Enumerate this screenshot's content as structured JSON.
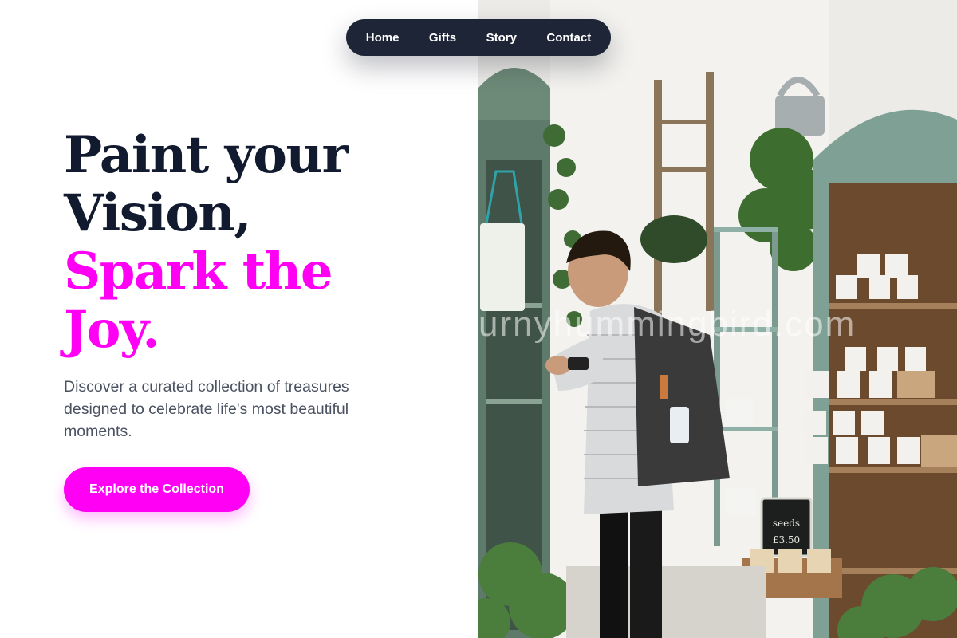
{
  "nav": {
    "items": [
      {
        "label": "Home"
      },
      {
        "label": "Gifts"
      },
      {
        "label": "Story"
      },
      {
        "label": "Contact"
      }
    ]
  },
  "hero": {
    "headline_line1": "Paint your",
    "headline_line2": "Vision,",
    "headline_accent_line1": "Spark the",
    "headline_accent_line2": "Joy.",
    "subtext": "Discover a curated collection of treasures designed to celebrate life's most beautiful moments.",
    "cta_label": "Explore the Collection"
  },
  "photo": {
    "watermark_text": "urnyhummingbird.com",
    "chalkboard_line1": "seeds",
    "chalkboard_line2": "£3.50"
  },
  "colors": {
    "accent": "#ff00f5",
    "headline": "#111a2e",
    "nav_background": "#1e2537"
  }
}
